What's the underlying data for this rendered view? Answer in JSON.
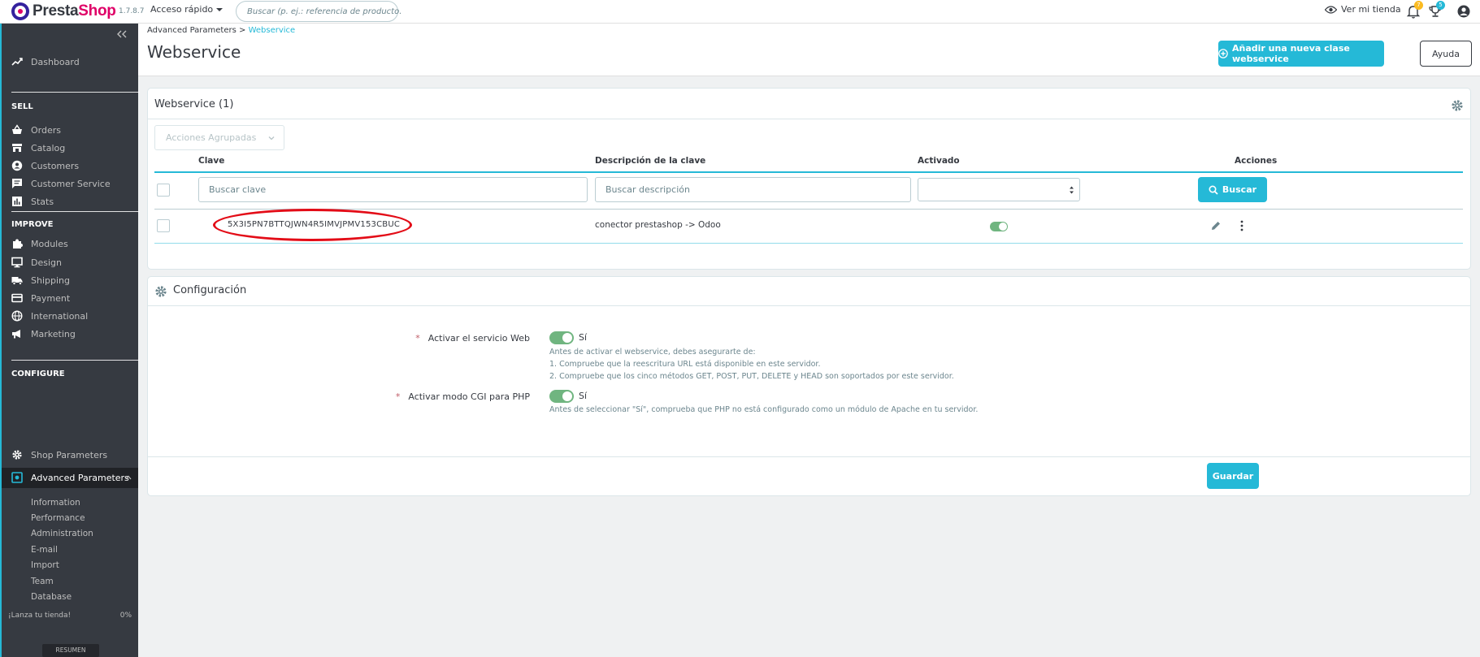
{
  "topbar": {
    "logo_part1": "Presta",
    "logo_part2": "Shop",
    "version": "1.7.8.7",
    "quick_access": "Acceso rápido",
    "search_placeholder": "Buscar (p. ej.: referencia de producto.",
    "view_shop": "Ver mi tienda",
    "notif_orders_count": "7",
    "notif_trophy_count": "5"
  },
  "sidebar": {
    "dashboard": "Dashboard",
    "sections": [
      {
        "title": "SELL",
        "items": [
          "Orders",
          "Catalog",
          "Customers",
          "Customer Service",
          "Stats"
        ]
      },
      {
        "title": "IMPROVE",
        "items": [
          "Modules",
          "Design",
          "Shipping",
          "Payment",
          "International",
          "Marketing"
        ]
      },
      {
        "title": "CONFIGURE",
        "items": [
          "Shop Parameters",
          "Advanced Parameters"
        ]
      }
    ],
    "subitems": [
      "Information",
      "Performance",
      "Administration",
      "E-mail",
      "Import",
      "Team",
      "Database"
    ],
    "launch_label": "¡Lanza tu tienda!",
    "launch_percent": "0%",
    "resumen": "RESUMEN"
  },
  "header": {
    "breadcrumb_parent": "Advanced Parameters",
    "breadcrumb_separator": ">",
    "breadcrumb_current": "Webservice",
    "title": "Webservice",
    "add_button": "Añadir una nueva clase webservice",
    "help_button": "Ayuda"
  },
  "webservice_panel": {
    "title": "Webservice (1)",
    "bulk_actions": "Acciones Agrupadas",
    "columns": {
      "key": "Clave",
      "description": "Descripción de la clave",
      "active": "Activado",
      "actions": "Acciones"
    },
    "filter_key_placeholder": "Buscar clave",
    "filter_desc_placeholder": "Buscar descripción",
    "search_button": "Buscar",
    "rows": [
      {
        "key": "5X3I5PN7BTTQJWN4R5IMVJPMV153CBUC",
        "description": "conector prestashop -> Odoo",
        "active": true
      }
    ]
  },
  "config_panel": {
    "title": "Configuración",
    "fields": [
      {
        "label": "Activar el servicio Web",
        "value": "Sí",
        "help": [
          "Antes de activar el webservice, debes asegurarte de:",
          "1. Compruebe que la reescritura URL está disponible en este servidor.",
          "2. Compruebe que los cinco métodos GET, POST, PUT, DELETE y HEAD son soportados por este servidor."
        ]
      },
      {
        "label": "Activar modo CGI para PHP",
        "value": "Sí",
        "help": [
          "Antes de seleccionar \"Sí\", comprueba que PHP no está configurado como un módulo de Apache en tu servidor."
        ]
      }
    ],
    "save_button": "Guardar"
  },
  "colors": {
    "accent": "#25b9d7",
    "sidebar": "#363a41",
    "highlight": "#e30c17",
    "toggle_on": "#70b580"
  }
}
